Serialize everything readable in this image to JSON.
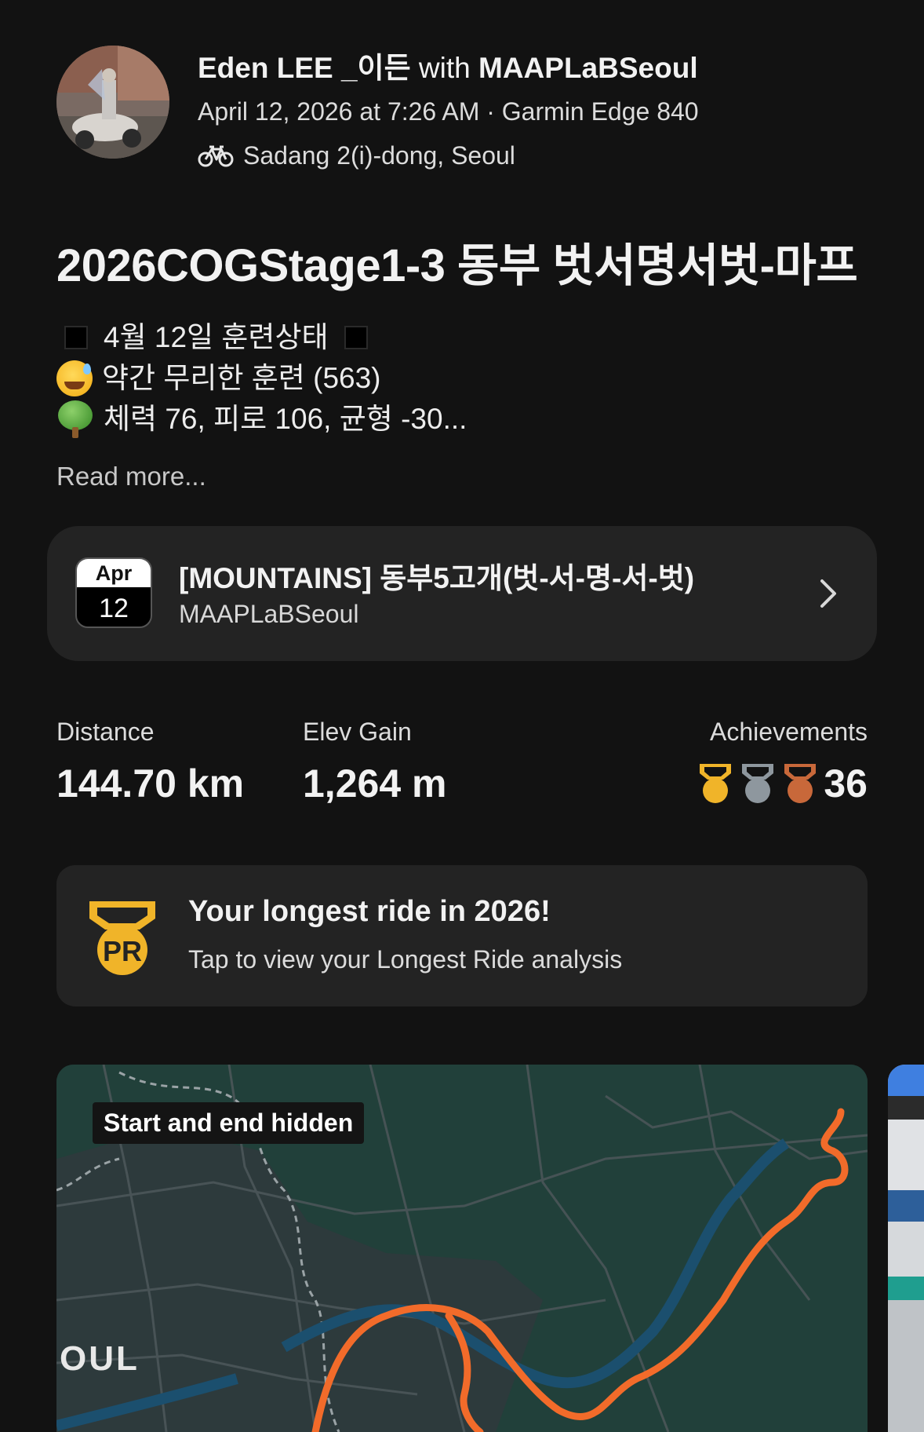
{
  "header": {
    "athlete_name": "Eden LEE _이든",
    "with_text": "with",
    "club_name": "MAAPLaBSeoul",
    "meta": "April 12, 2026 at 7:26 AM · Garmin Edge 840",
    "location": "Sadang 2(i)-dong, Seoul",
    "activity_icon": "bike-icon"
  },
  "activity": {
    "title": "2026COGStage1-3 동부 벗서명서벗-마프",
    "description": {
      "line1": "4월 12일 훈련상태",
      "line2": "약간 무리한 훈련 (563)",
      "line3": "체력 76, 피로 106, 균형 -30..."
    },
    "read_more": "Read more..."
  },
  "event": {
    "month": "Apr",
    "day": "12",
    "title": "[MOUNTAINS] 동부5고개(벗-서-명-서-벗)",
    "club": "MAAPLaBSeoul"
  },
  "stats": {
    "distance_label": "Distance",
    "distance_value": "144.70 km",
    "elev_label": "Elev Gain",
    "elev_value": "1,264 m",
    "achievements_label": "Achievements",
    "achievements_value": "36",
    "medal_colors": [
      "#f0b429",
      "#8e979e",
      "#c8683a"
    ]
  },
  "pr": {
    "badge_text": "PR",
    "title": "Your longest ride in 2026!",
    "subtitle": "Tap to view your Longest Ride analysis",
    "badge_color": "#f0b429"
  },
  "map": {
    "privacy_label": "Start and end hidden",
    "city_label": "OUL",
    "route_color": "#f26b2a"
  }
}
